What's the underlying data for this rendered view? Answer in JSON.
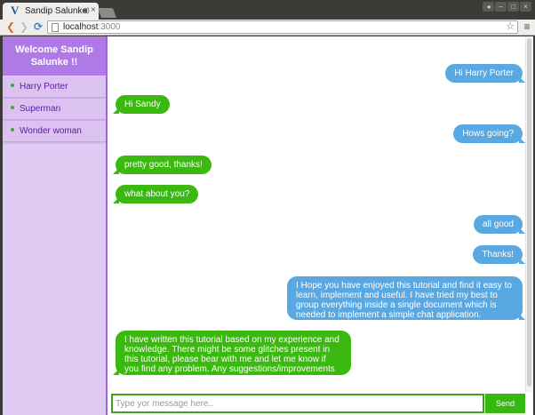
{
  "browser": {
    "tab_title": "Sandip Salunke",
    "tab_audio_icon": "speaker-icon",
    "tab_close": "×",
    "url_host": "localhost",
    "url_port": ":3000",
    "back": "❮",
    "forward": "❯",
    "reload": "⟳",
    "star": "☆",
    "menu": "≡",
    "win_buttons": [
      "◂",
      "–",
      "□",
      "×"
    ]
  },
  "sidebar": {
    "welcome": "Welcome Sandip Salunke !!",
    "online_color": "#38a845",
    "contacts": [
      {
        "name": "Harry Porter"
      },
      {
        "name": "Superman"
      },
      {
        "name": "Wonder woman"
      }
    ]
  },
  "chat": {
    "sent_color": "#5aa8e2",
    "received_color": "#3bb910",
    "messages": [
      {
        "side": "right",
        "text": "Hi Harry Porter"
      },
      {
        "side": "left",
        "text": "Hi Sandy"
      },
      {
        "side": "right",
        "text": "Hows going?"
      },
      {
        "side": "left",
        "text": "pretty good, thanks!"
      },
      {
        "side": "left",
        "text": "what about you?"
      },
      {
        "side": "right",
        "text": "all good"
      },
      {
        "side": "right",
        "text": "Thanks!"
      },
      {
        "side": "right",
        "text": "I Hope you have enjoyed this tutorial and find it easy to learn, implement and useful. I have tried my best to group everything inside a single document which is needed to implement a simple chat application."
      },
      {
        "side": "left",
        "text": "I have written this tutorial based on my experience and knowledge. There might be some glitches present in this tutorial, please bear with me and let me know if you find any problem. Any suggestions/improvements in this tutorial are welcome."
      }
    ]
  },
  "composer": {
    "placeholder": "Type yor message here..",
    "value": "",
    "send_label": "Send"
  }
}
